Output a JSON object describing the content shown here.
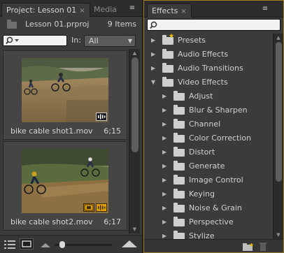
{
  "project": {
    "tabs": [
      {
        "label": "Project: Lesson 01",
        "close": "×"
      },
      {
        "label": "Media"
      }
    ],
    "menu_icon": "≡",
    "file_name": "Lesson 01.prproj",
    "item_count": "9 Items",
    "in_label": "In:",
    "in_value": "All",
    "clips": [
      {
        "name": "bike cable shot1.mov",
        "duration": "6;15"
      },
      {
        "name": "bike cable shot2.mov",
        "duration": "6;17"
      }
    ],
    "zoom_level": 0.1
  },
  "effects": {
    "tab": {
      "label": "Effects",
      "close": "×"
    },
    "menu_icon": "≡",
    "items": [
      {
        "label": "Presets",
        "level": 0,
        "expanded": false
      },
      {
        "label": "Audio Effects",
        "level": 0,
        "expanded": false
      },
      {
        "label": "Audio Transitions",
        "level": 0,
        "expanded": false
      },
      {
        "label": "Video Effects",
        "level": 0,
        "expanded": true
      },
      {
        "label": "Adjust",
        "level": 1,
        "expanded": false
      },
      {
        "label": "Blur & Sharpen",
        "level": 1,
        "expanded": false
      },
      {
        "label": "Channel",
        "level": 1,
        "expanded": false
      },
      {
        "label": "Color Correction",
        "level": 1,
        "expanded": false
      },
      {
        "label": "Distort",
        "level": 1,
        "expanded": false
      },
      {
        "label": "Generate",
        "level": 1,
        "expanded": false
      },
      {
        "label": "Image Control",
        "level": 1,
        "expanded": false
      },
      {
        "label": "Keying",
        "level": 1,
        "expanded": false
      },
      {
        "label": "Noise & Grain",
        "level": 1,
        "expanded": false
      },
      {
        "label": "Perspective",
        "level": 1,
        "expanded": false
      },
      {
        "label": "Stylize",
        "level": 1,
        "expanded": false
      }
    ]
  },
  "colors": {
    "accent": "#a07c22",
    "badge_orange": "#e0a000",
    "panel_bg": "#3b3b3b"
  }
}
